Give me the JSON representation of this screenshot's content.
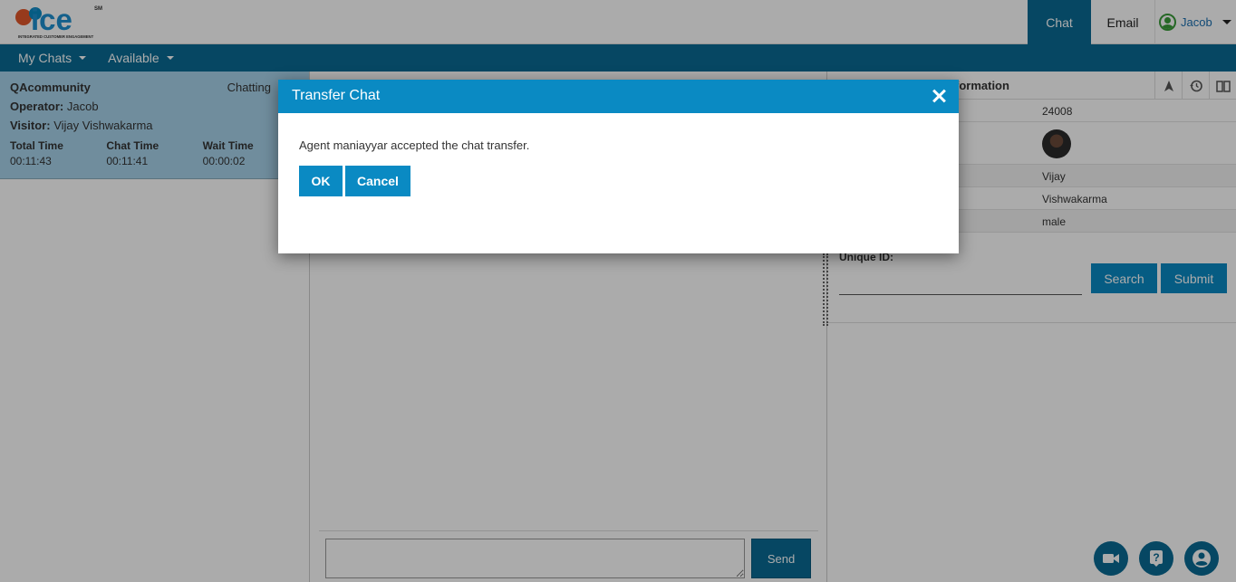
{
  "brand": {
    "logo_text": "ice",
    "logo_sub": "INTEGRATED CUSTOMER ENGAGEMENT",
    "logo_mark": "SM"
  },
  "top_tabs": [
    {
      "label": "Chat",
      "active": true
    },
    {
      "label": "Email",
      "active": false
    }
  ],
  "user": {
    "name": "Jacob",
    "icon": "user-circle-icon"
  },
  "nav": {
    "my_chats": "My Chats",
    "availability": "Available"
  },
  "chat_card": {
    "queue": "QAcommunity",
    "status": "Chatting",
    "operator_label": "Operator:",
    "operator": "Jacob",
    "visitor_label": "Visitor:",
    "visitor": "Vijay Vishwakarma",
    "times": [
      {
        "label": "Total Time",
        "value": "00:11:43"
      },
      {
        "label": "Chat Time",
        "value": "00:11:41"
      },
      {
        "label": "Wait Time",
        "value": "00:00:02"
      }
    ]
  },
  "compose": {
    "send_label": "Send"
  },
  "visitor_info": {
    "title": "formation",
    "id_value": "24008",
    "first_name": "Vijay",
    "last_name": "Vishwakarma",
    "gender": "male",
    "unique_id_label": "Unique ID:",
    "search_label": "Search",
    "submit_label": "Submit"
  },
  "modal": {
    "title": "Transfer Chat",
    "message": "Agent maniayyar accepted the chat transfer.",
    "ok_label": "OK",
    "cancel_label": "Cancel"
  },
  "colors": {
    "brand_dark": "#0a6b94",
    "brand_light": "#0a8ac3",
    "card_bg": "#a8d3eb"
  }
}
